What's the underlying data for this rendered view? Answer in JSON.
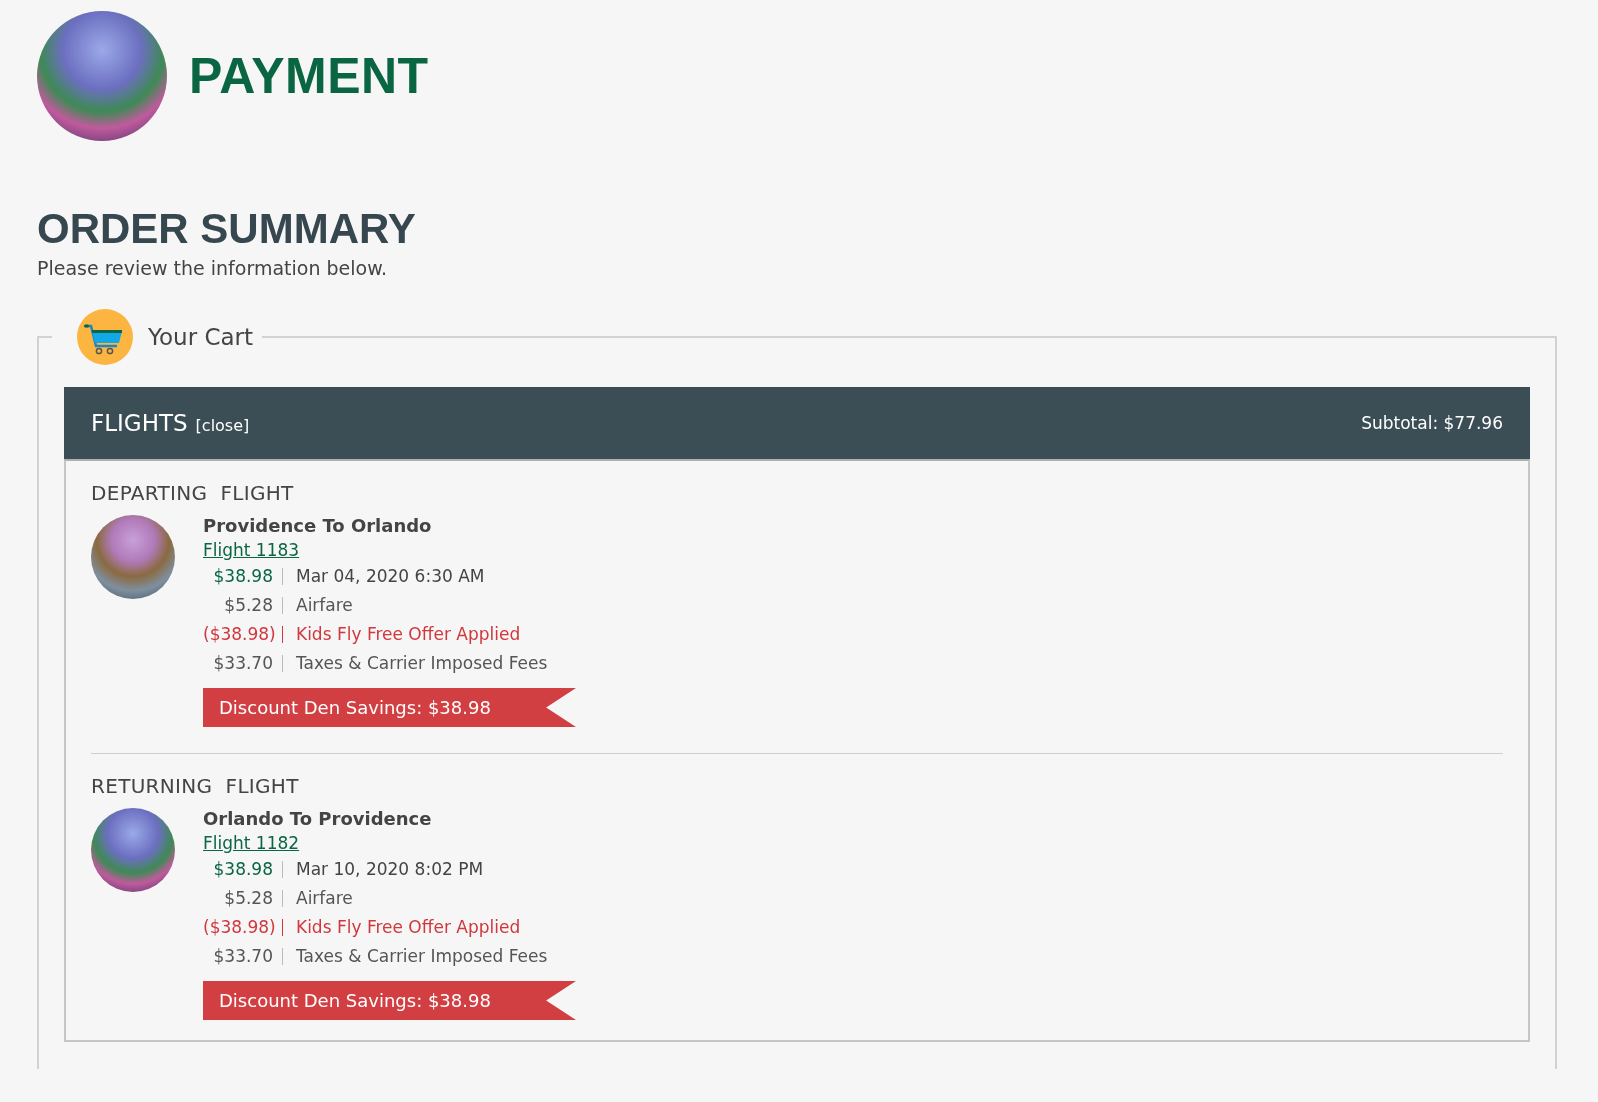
{
  "page_title": "PAYMENT",
  "order_summary": {
    "title": "ORDER SUMMARY",
    "subtitle": "Please review the information below."
  },
  "cart": {
    "title": "Your Cart",
    "section": {
      "title": "FLIGHTS",
      "close_link": "[close]",
      "subtotal": "Subtotal: $77.96",
      "flights": [
        {
          "heading": "DEPARTING  FLIGHT",
          "route": "Providence To Orlando",
          "flight_link": "Flight 1183",
          "lines": [
            {
              "kind": "price",
              "amount": "$38.98",
              "label": "Mar 04, 2020 6:30 AM"
            },
            {
              "kind": "normal",
              "amount": "$5.28",
              "label": "Airfare"
            },
            {
              "kind": "offer",
              "amount": "($38.98)",
              "label": "Kids Fly Free Offer Applied"
            },
            {
              "kind": "normal",
              "amount": "$33.70",
              "label": "Taxes & Carrier Imposed Fees"
            }
          ],
          "savings": "Discount Den Savings: $38.98"
        },
        {
          "heading": "RETURNING  FLIGHT",
          "route": "Orlando To Providence",
          "flight_link": "Flight 1182",
          "lines": [
            {
              "kind": "price",
              "amount": "$38.98",
              "label": "Mar 10, 2020 8:02 PM"
            },
            {
              "kind": "normal",
              "amount": "$5.28",
              "label": "Airfare"
            },
            {
              "kind": "offer",
              "amount": "($38.98)",
              "label": "Kids Fly Free Offer Applied"
            },
            {
              "kind": "normal",
              "amount": "$33.70",
              "label": "Taxes & Carrier Imposed Fees"
            }
          ],
          "savings": "Discount Den Savings: $38.98"
        }
      ]
    }
  }
}
